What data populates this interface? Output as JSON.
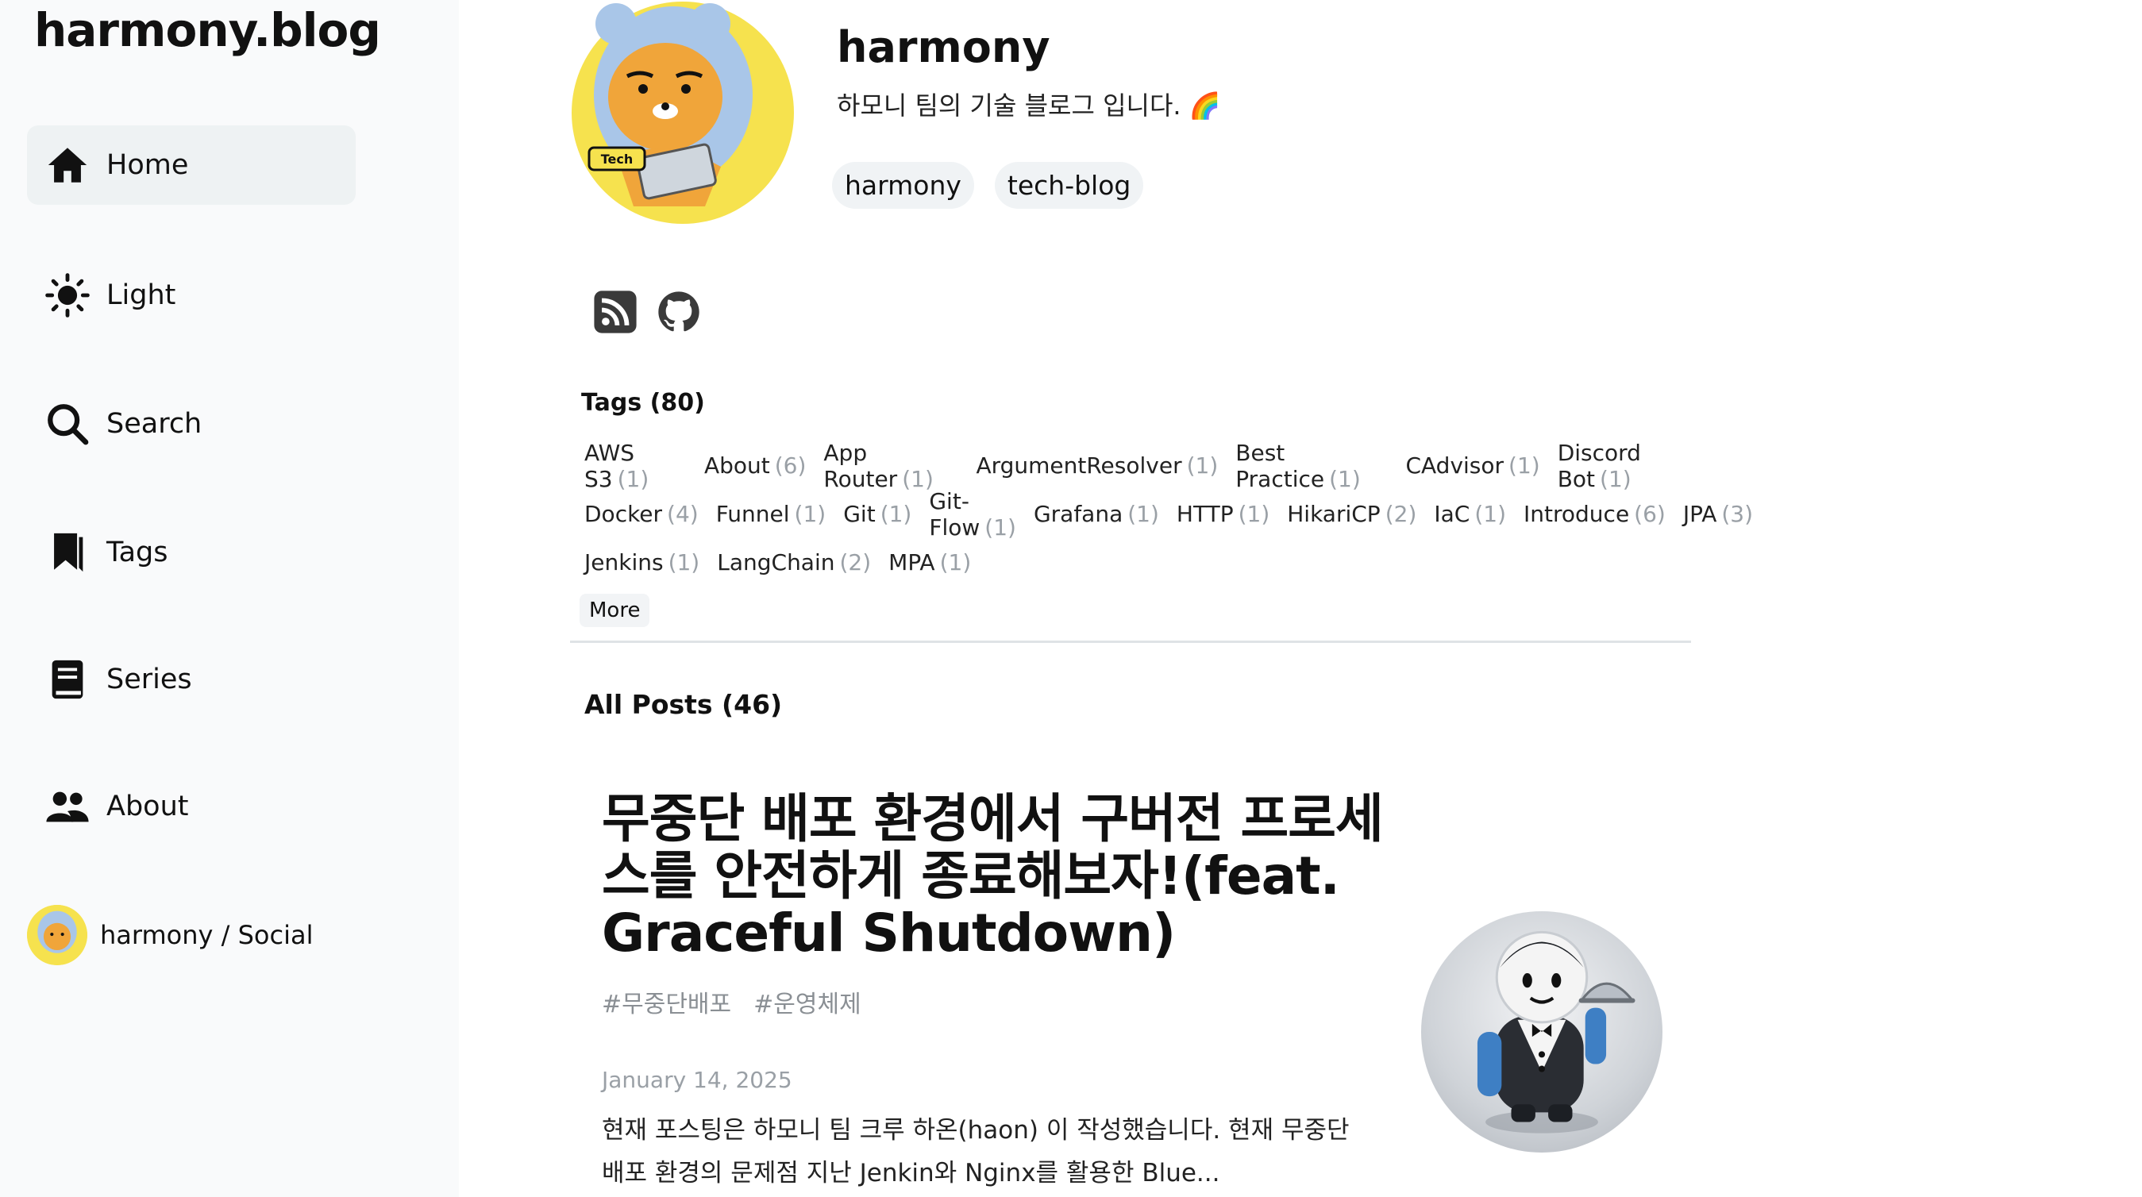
{
  "brand": "harmony.blog",
  "nav": {
    "items": [
      {
        "label": "Home"
      },
      {
        "label": "Light"
      },
      {
        "label": "Search"
      },
      {
        "label": "Tags"
      },
      {
        "label": "Series"
      },
      {
        "label": "About"
      }
    ],
    "social_label": "harmony / Social"
  },
  "profile": {
    "name": "harmony",
    "description": "하모니 팀의 기술 블로그 입니다. 🌈",
    "tags": [
      "harmony",
      "tech-blog"
    ],
    "avatar_badge": "Tech"
  },
  "tags_section": {
    "title": "Tags (80)",
    "rows": [
      [
        {
          "name": "AWS S3",
          "count": "(1)"
        },
        {
          "name": "About",
          "count": "(6)"
        },
        {
          "name": "App Router",
          "count": "(1)"
        },
        {
          "name": "ArgumentResolver",
          "count": "(1)"
        },
        {
          "name": "Best Practice",
          "count": "(1)"
        },
        {
          "name": "CAdvisor",
          "count": "(1)"
        },
        {
          "name": "Discord Bot",
          "count": "(1)"
        }
      ],
      [
        {
          "name": "Docker",
          "count": "(4)"
        },
        {
          "name": "Funnel",
          "count": "(1)"
        },
        {
          "name": "Git",
          "count": "(1)"
        },
        {
          "name": "Git-Flow",
          "count": "(1)"
        },
        {
          "name": "Grafana",
          "count": "(1)"
        },
        {
          "name": "HTTP",
          "count": "(1)"
        },
        {
          "name": "HikariCP",
          "count": "(2)"
        },
        {
          "name": "IaC",
          "count": "(1)"
        },
        {
          "name": "Introduce",
          "count": "(6)"
        },
        {
          "name": "JPA",
          "count": "(3)"
        }
      ],
      [
        {
          "name": "Jenkins",
          "count": "(1)"
        },
        {
          "name": "LangChain",
          "count": "(2)"
        },
        {
          "name": "MPA",
          "count": "(1)"
        }
      ]
    ],
    "more_label": "More"
  },
  "posts": {
    "title": "All Posts (46)",
    "items": [
      {
        "title": "무중단 배포 환경에서 구버전 프로세스를 안전하게 종료해보자!(feat. Graceful Shutdown)",
        "tags": [
          "#무중단배포",
          "#운영체제"
        ],
        "date": "January 14, 2025",
        "excerpt": "현재 포스팅은 하모니 팀 크루 하온(haon) 이 작성했습니다. 현재 무중단 배포 환경의 문제점 지난 Jenkin와 Nginx를 활용한 Blue..."
      }
    ]
  },
  "colors": {
    "sidebar_bg": "#f9fafb",
    "active_nav_bg": "#eef2f3",
    "pill_bg": "#f0f3f5",
    "muted_text": "#9aa0a6",
    "avatar_yellow": "#f6e24e"
  }
}
